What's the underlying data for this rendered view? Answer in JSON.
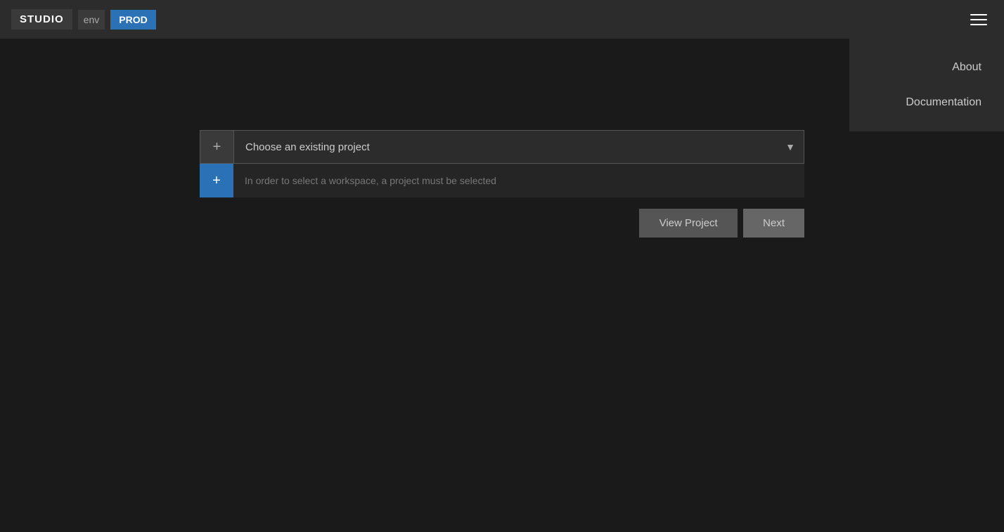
{
  "header": {
    "studio_label": "STUDIO",
    "env_label": "env",
    "prod_label": "PROD"
  },
  "hamburger_icon": "≡",
  "dropdown_menu": {
    "items": [
      {
        "id": "about",
        "label": "About"
      },
      {
        "id": "documentation",
        "label": "Documentation"
      }
    ]
  },
  "project_panel": {
    "select_placeholder": "Choose an existing project",
    "workspace_hint": "In order to select a workspace, a project must be selected",
    "plus_icon_1": "+",
    "plus_icon_2": "+",
    "chevron": "▼"
  },
  "buttons": {
    "view_project": "View Project",
    "next": "Next"
  }
}
